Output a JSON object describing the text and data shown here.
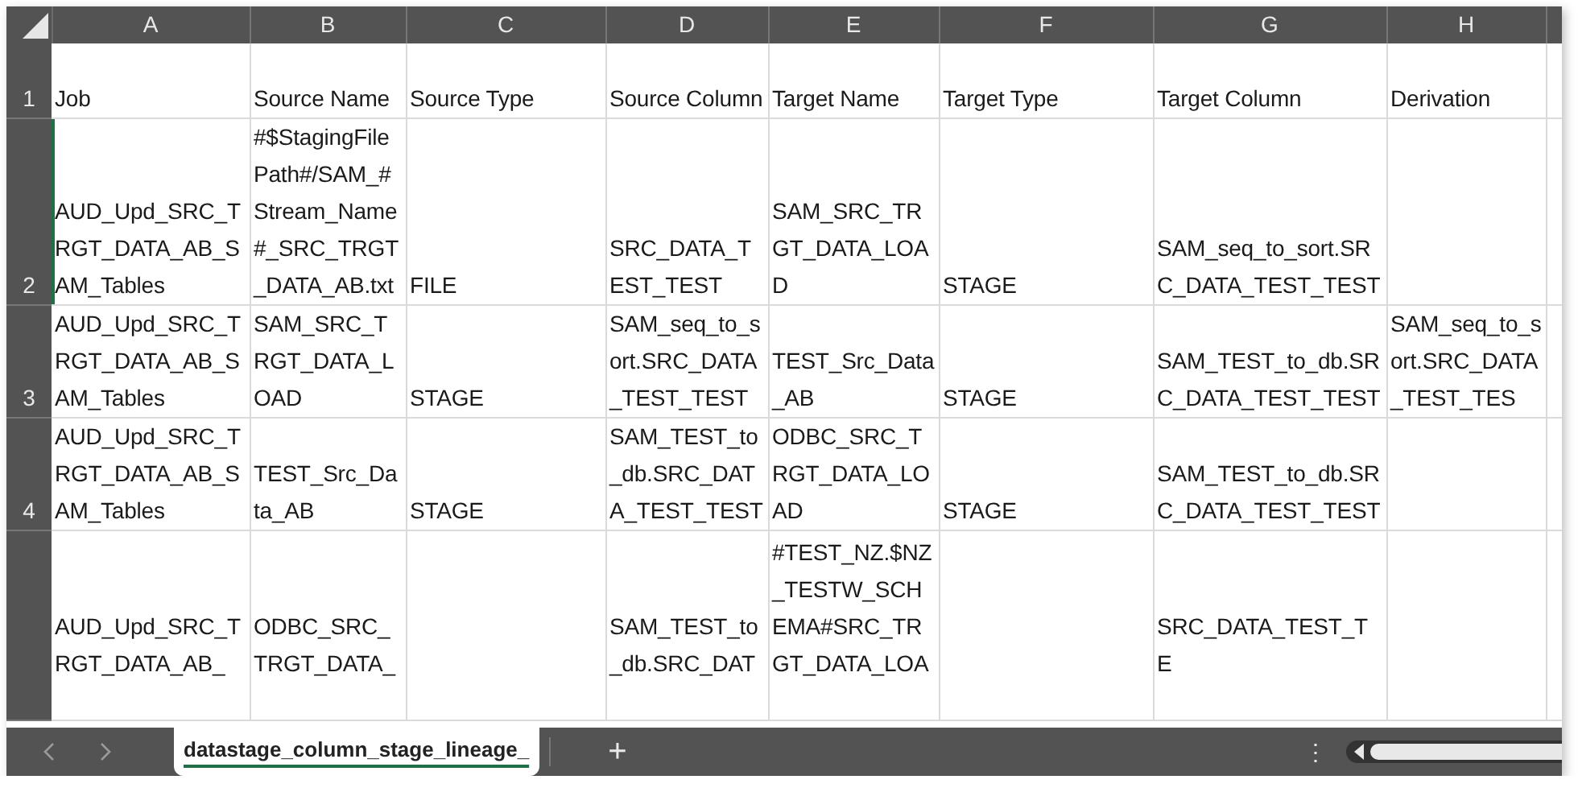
{
  "column_headers": [
    "A",
    "B",
    "C",
    "D",
    "E",
    "F",
    "G",
    "H"
  ],
  "rows": [
    {
      "number": "1",
      "cells": [
        "Job",
        "Source Name",
        "Source Type",
        "Source Column",
        "Target Name",
        "Target Type",
        "Target Column",
        "Derivation"
      ]
    },
    {
      "number": "2",
      "cells": [
        "AUD_Upd_SRC_TRGT_DATA_AB_SAM_Tables",
        "#$StagingFilePath#/SAM_#Stream_Name#_SRC_TRGT_DATA_AB.txt",
        "FILE",
        "SRC_DATA_TEST_TEST",
        "SAM_SRC_TRGT_DATA_LOAD",
        "STAGE",
        "SAM_seq_to_sort.SRC_DATA_TEST_TEST",
        ""
      ]
    },
    {
      "number": "3",
      "cells": [
        "AUD_Upd_SRC_TRGT_DATA_AB_SAM_Tables",
        "SAM_SRC_TRGT_DATA_LOAD",
        "STAGE",
        "SAM_seq_to_sort.SRC_DATA_TEST_TEST",
        "TEST_Src_Data_AB",
        "STAGE",
        "SAM_TEST_to_db.SRC_DATA_TEST_TEST",
        "SAM_seq_to_sort.SRC_DATA_TEST_TES"
      ]
    },
    {
      "number": "4",
      "cells": [
        "AUD_Upd_SRC_TRGT_DATA_AB_SAM_Tables",
        "TEST_Src_Data_AB",
        "STAGE",
        "SAM_TEST_to_db.SRC_DATA_TEST_TEST",
        "ODBC_SRC_TRGT_DATA_LOAD",
        "STAGE",
        "SAM_TEST_to_db.SRC_DATA_TEST_TEST",
        ""
      ]
    },
    {
      "number": "",
      "cells": [
        "AUD_Upd_SRC_TRGT_DATA_AB_",
        "ODBC_SRC_TRGT_DATA_",
        "",
        "SAM_TEST_to_db.SRC_DAT",
        "#TEST_NZ.$NZ_TESTW_SCHEMA#SRC_TRGT_DATA_LOA",
        "",
        "SRC_DATA_TEST_TE",
        ""
      ]
    }
  ],
  "sheet_tabs": [
    {
      "label": "datastage_column_stage_lineage_",
      "selected": true
    }
  ],
  "new_sheet_button": "+",
  "more_menu": "⋮"
}
